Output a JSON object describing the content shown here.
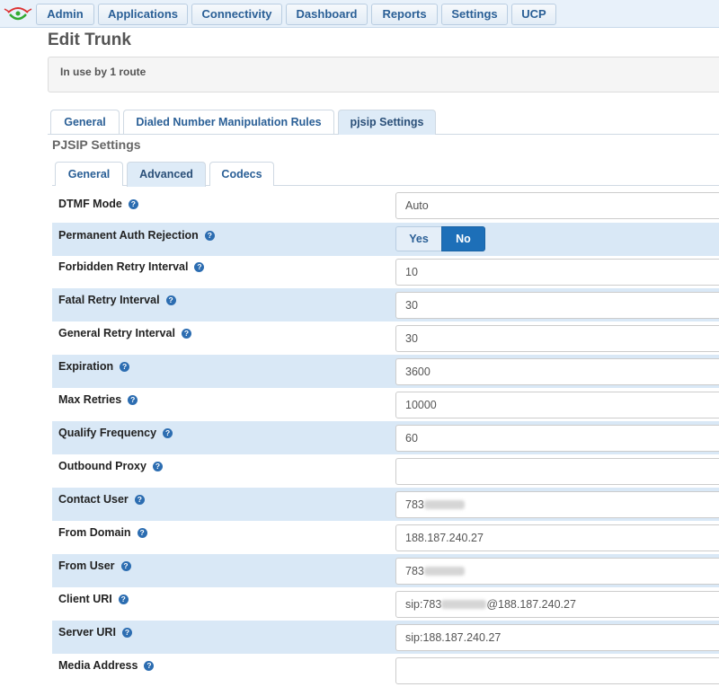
{
  "nav": {
    "items": [
      "Admin",
      "Applications",
      "Connectivity",
      "Dashboard",
      "Reports",
      "Settings",
      "UCP"
    ]
  },
  "page": {
    "title": "Edit Trunk",
    "in_use": "In use by 1 route"
  },
  "main_tabs": [
    "General",
    "Dialed Number Manipulation Rules",
    "pjsip Settings"
  ],
  "section": {
    "title": "PJSIP Settings",
    "tabs": [
      "General",
      "Advanced",
      "Codecs"
    ]
  },
  "fields": {
    "dtmf_mode": {
      "label": "DTMF Mode",
      "value": "Auto"
    },
    "perm_auth": {
      "label": "Permanent Auth Rejection",
      "yes": "Yes",
      "no": "No",
      "selected": "No"
    },
    "forbidden_retry": {
      "label": "Forbidden Retry Interval",
      "value": "10"
    },
    "fatal_retry": {
      "label": "Fatal Retry Interval",
      "value": "30"
    },
    "general_retry": {
      "label": "General Retry Interval",
      "value": "30"
    },
    "expiration": {
      "label": "Expiration",
      "value": "3600"
    },
    "max_retries": {
      "label": "Max Retries",
      "value": "10000"
    },
    "qualify_freq": {
      "label": "Qualify Frequency",
      "value": "60"
    },
    "outbound_proxy": {
      "label": "Outbound Proxy",
      "value": ""
    },
    "contact_user": {
      "label": "Contact User",
      "value": "783"
    },
    "from_domain": {
      "label": "From Domain",
      "value": "188.187.240.27"
    },
    "from_user": {
      "label": "From User",
      "value": "783"
    },
    "client_uri": {
      "label": "Client URI",
      "prefix": "sip:783",
      "suffix": "@188.187.240.27"
    },
    "server_uri": {
      "label": "Server URI",
      "value": "sip:188.187.240.27"
    },
    "media_address": {
      "label": "Media Address",
      "value": ""
    }
  },
  "help_glyph": "?",
  "colors": {
    "accent": "#1d6fb8",
    "row_alt": "#d9e8f6",
    "link": "#2a5f96"
  }
}
